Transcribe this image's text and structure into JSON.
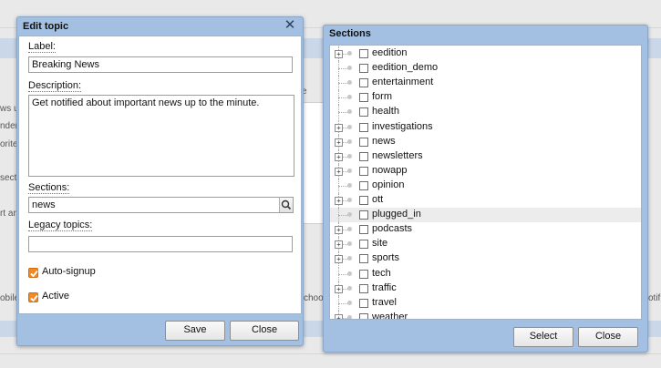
{
  "background": {
    "fragments": [
      "ws up",
      "nderi",
      "orite",
      "sect",
      "rt ar",
      "obile",
      "e",
      "choo",
      "otifi"
    ]
  },
  "edit_topic": {
    "title": "Edit topic",
    "label_caption": "Label:",
    "label_value": "Breaking News",
    "description_caption": "Description:",
    "description_value": "Get notified about important news up to the minute.",
    "sections_caption": "Sections:",
    "sections_value": "news",
    "legacy_caption": "Legacy topics:",
    "legacy_value": "",
    "auto_signup_label": "Auto-signup",
    "auto_signup_checked": true,
    "active_label": "Active",
    "active_checked": true,
    "save_label": "Save",
    "close_label": "Close",
    "accent_color": "#f08a24"
  },
  "sections_dialog": {
    "title": "Sections",
    "items": [
      {
        "label": "eedition",
        "expandable": true
      },
      {
        "label": "eedition_demo",
        "expandable": false
      },
      {
        "label": "entertainment",
        "expandable": false
      },
      {
        "label": "form",
        "expandable": false
      },
      {
        "label": "health",
        "expandable": false
      },
      {
        "label": "investigations",
        "expandable": true
      },
      {
        "label": "news",
        "expandable": true
      },
      {
        "label": "newsletters",
        "expandable": true
      },
      {
        "label": "nowapp",
        "expandable": true
      },
      {
        "label": "opinion",
        "expandable": false
      },
      {
        "label": "ott",
        "expandable": true
      },
      {
        "label": "plugged_in",
        "expandable": false,
        "highlighted": true
      },
      {
        "label": "podcasts",
        "expandable": true
      },
      {
        "label": "site",
        "expandable": true
      },
      {
        "label": "sports",
        "expandable": true
      },
      {
        "label": "tech",
        "expandable": false
      },
      {
        "label": "traffic",
        "expandable": true
      },
      {
        "label": "travel",
        "expandable": false
      },
      {
        "label": "weather",
        "expandable": true
      }
    ],
    "select_label": "Select",
    "close_label": "Close"
  }
}
